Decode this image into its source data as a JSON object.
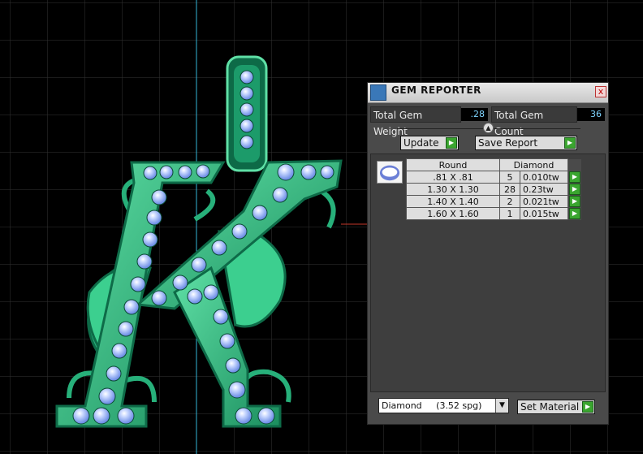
{
  "panel": {
    "title": "GEM REPORTER",
    "close_label": "x",
    "total_weight_label": "Total Gem Weight",
    "total_weight_value": ".28",
    "total_count_label": "Total Gem Count",
    "total_count_value": "36",
    "update_label": "Update",
    "save_report_label": "Save Report",
    "table": {
      "shape_header": "Round",
      "material_header": "Diamond",
      "rows": [
        {
          "size": ".81 X .81",
          "count": "5",
          "weight": "0.010tw"
        },
        {
          "size": "1.30 X 1.30",
          "count": "28",
          "weight": "0.23tw"
        },
        {
          "size": "1.40 X 1.40",
          "count": "2",
          "weight": "0.021tw"
        },
        {
          "size": "1.60 X 1.60",
          "count": "1",
          "weight": "0.015tw"
        }
      ]
    },
    "material_select": "Diamond     (3.52 spg)",
    "set_material_label": "Set Material"
  },
  "colors": {
    "background": "#000000",
    "grid": "#3a3a3a",
    "metal": "#27b07a",
    "metal_dark": "#0e6b48",
    "stone": "#9ab7ff",
    "axis_vertical": "#34b6d8",
    "axis_horizontal": "#c4382a"
  }
}
